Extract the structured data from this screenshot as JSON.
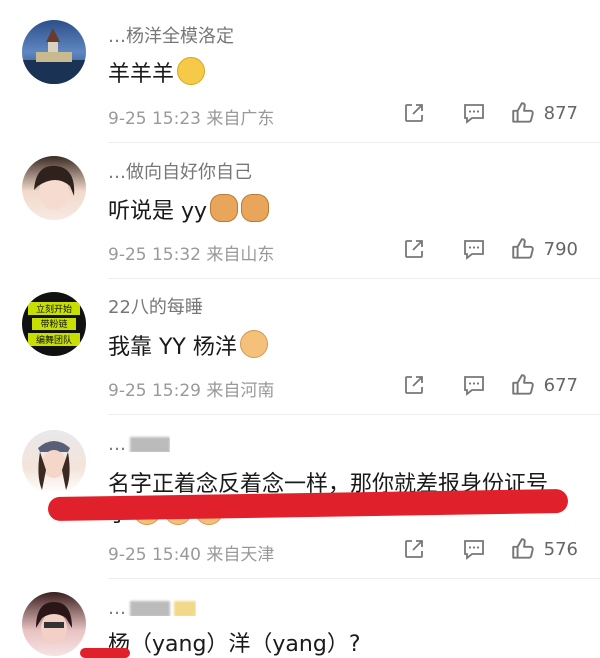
{
  "comments": [
    {
      "username": "…杨洋全模洛定",
      "text": "羊羊羊",
      "emoji": [
        "smile"
      ],
      "meta": "9-25 15:23 来自广东",
      "likes": "877"
    },
    {
      "username": "…做向自好你自己",
      "text": "听说是 yy",
      "emoji": [
        "dog",
        "dog"
      ],
      "meta": "9-25 15:32 来自山东",
      "likes": "790"
    },
    {
      "username": "22八的每睡",
      "text": "我靠 YY 杨洋",
      "emoji": [
        "hand"
      ],
      "meta": "9-25 15:29 来自河南",
      "likes": "677"
    },
    {
      "username": "…",
      "text": "名字正着念反着念一样，那你就差报身份证号",
      "text2": "了",
      "meta": "9-25 15:40 来自天津",
      "likes": "576"
    },
    {
      "username": "…",
      "text": "杨（yang）洋（yang）?"
    }
  ],
  "avatar_badge_text": [
    "立刻开始",
    "带粉链",
    "编舞团队"
  ],
  "colors": {
    "highlight": "#e0202a",
    "meta": "#999999"
  },
  "icons": {
    "share": "share-icon",
    "comment": "comment-icon",
    "like": "thumbs-up-icon"
  }
}
